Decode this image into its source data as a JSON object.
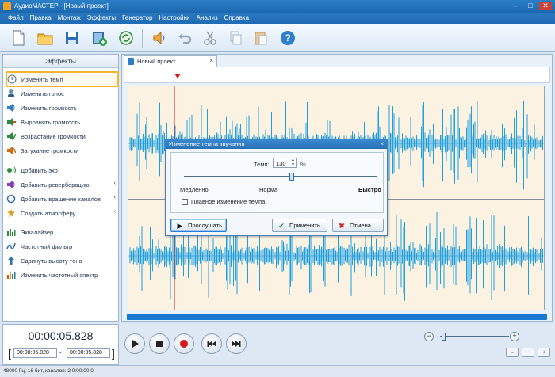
{
  "window": {
    "title": "АудиоМАСТЕР - [Новый проект]"
  },
  "menu": [
    "Файл",
    "Правка",
    "Монтаж",
    "Эффекты",
    "Генератор",
    "Настройки",
    "Анализ",
    "Справка"
  ],
  "toolbar": {
    "icons": [
      "new-file",
      "open-folder",
      "save",
      "export-video",
      "convert",
      "edit-audio",
      "undo",
      "cut",
      "copy",
      "paste",
      "help"
    ]
  },
  "sidebar": {
    "header": "Эффекты",
    "items": [
      {
        "label": "Изменить темп",
        "icon": "tempo-icon",
        "selected": true
      },
      {
        "label": "Изменить голос",
        "icon": "voice-icon"
      },
      {
        "label": "Изменить громкость",
        "icon": "volume-icon"
      },
      {
        "label": "Выровнять громкость",
        "icon": "normalize-icon"
      },
      {
        "label": "Возрастание громкости",
        "icon": "fade-in-icon"
      },
      {
        "label": "Затухание громкости",
        "icon": "fade-out-icon"
      },
      {
        "label": "Добавить эхо",
        "icon": "echo-icon"
      },
      {
        "label": "Добавить реверберацию",
        "icon": "reverb-icon",
        "has_submenu": true
      },
      {
        "label": "Добавить вращение каналов",
        "icon": "rotate-icon",
        "has_submenu": true
      },
      {
        "label": "Создать атмосферу",
        "icon": "atmosphere-icon",
        "has_submenu": true
      },
      {
        "label": "Эквалайзер",
        "icon": "equalizer-icon"
      },
      {
        "label": "Частотный фильтр",
        "icon": "filter-icon"
      },
      {
        "label": "Сдвинуть высоту тона",
        "icon": "pitch-icon"
      },
      {
        "label": "Изменить частотный спектр",
        "icon": "spectrum-icon"
      }
    ]
  },
  "editor": {
    "tab_label": "Новый проект",
    "tab_close": "×",
    "playhead_fraction": 0.11
  },
  "dialog": {
    "title": "Изменение темпа звучания",
    "close": "×",
    "tempo_label": "Темп:",
    "tempo_value": "130",
    "tempo_unit": "%",
    "slider_position_fraction": 0.61,
    "label_slow": "Медленно",
    "label_normal": "Норма",
    "label_fast": "Быстро",
    "smooth_label": "Плавное изменение темпа",
    "smooth_checked": false,
    "btn_listen": "Прослушать",
    "btn_apply": "Применить",
    "btn_cancel": "Отмена"
  },
  "bottom": {
    "current_time": "00:00:05.828",
    "range_start": "00:00:05.828",
    "range_dash": "-",
    "range_end": "00:00:05.828",
    "zoom_minus": "−",
    "zoom_plus": "+",
    "zoom_fraction": 0.05,
    "fit_buttons": [
      "↔",
      "⇔",
      "↕"
    ]
  },
  "status": {
    "text": "48000 Гц, 16 бит, каналов: 2   0:00:00.0"
  },
  "colors": {
    "accent": "#2b7fc6",
    "wave": "#1f9fe0",
    "wave_bg": "#fbf2e2",
    "playhead": "#d51d1d",
    "selection": "#f2b431"
  }
}
